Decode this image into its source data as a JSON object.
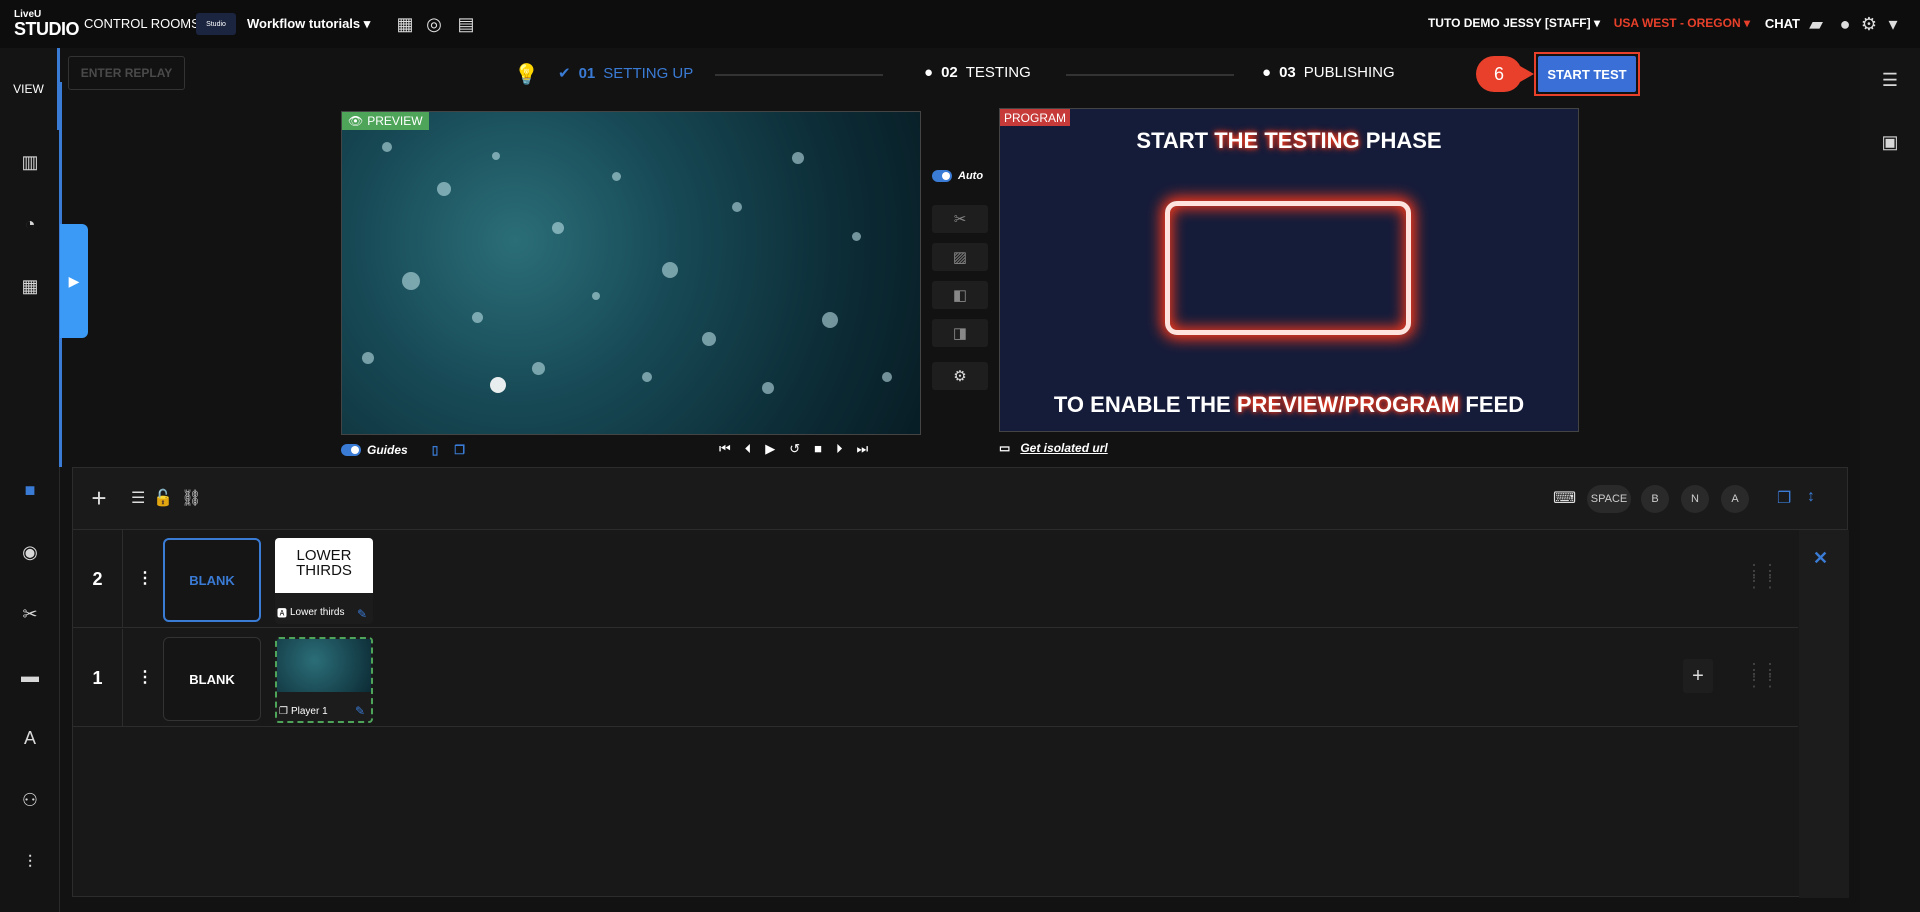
{
  "topbar": {
    "logo_top": "LiveU",
    "logo_main": "STUDIO",
    "control_rooms": "CONTROL ROOMS",
    "workflow_thumb": "Studio",
    "workflow_title": "Workflow tutorials ▾",
    "user": "TUTO DEMO JESSY [STAFF] ▾",
    "region": "USA WEST - OREGON ▾",
    "chat": "CHAT",
    "icons": [
      "calendar-icon",
      "lifebuoy-icon",
      "layout-icon",
      "chat-icon",
      "user-icon",
      "gear-icon"
    ]
  },
  "sidebar": {
    "view_label": "VIEW",
    "icons": [
      "chart-icon",
      "speedometer-icon",
      "dashboard-icon",
      "camera-icon",
      "broadcast-icon",
      "scissors-icon",
      "comment-icon",
      "text-icon",
      "users-icon",
      "sliders-icon"
    ]
  },
  "header": {
    "replay": "ENTER REPLAY",
    "steps": [
      {
        "num": "01",
        "label": "SETTING UP"
      },
      {
        "num": "02",
        "label": "TESTING"
      },
      {
        "num": "03",
        "label": "PUBLISHING"
      }
    ],
    "step_badge": "6",
    "start_test": "START TEST"
  },
  "preview": {
    "tag": "PREVIEW",
    "guides": "Guides"
  },
  "transition": {
    "auto": "Auto"
  },
  "program": {
    "tag": "PROGRAM",
    "line1_a": "START ",
    "line1_b": "THE TESTING",
    "line1_c": " PHASE",
    "line2_a": "TO ENABLE THE ",
    "line2_b": "PREVIEW/PROGRAM",
    "line2_c": " FEED",
    "isolated_url": "Get isolated url"
  },
  "layers": {
    "hotkeys": [
      "SPACE",
      "B",
      "N",
      "A"
    ],
    "rows": [
      {
        "num": "2",
        "blank": "BLANK",
        "source_thumb": "LOWER THIRDS",
        "source_label": "Lower thirds"
      },
      {
        "num": "1",
        "blank": "BLANK",
        "source_label": "Player 1"
      }
    ]
  }
}
